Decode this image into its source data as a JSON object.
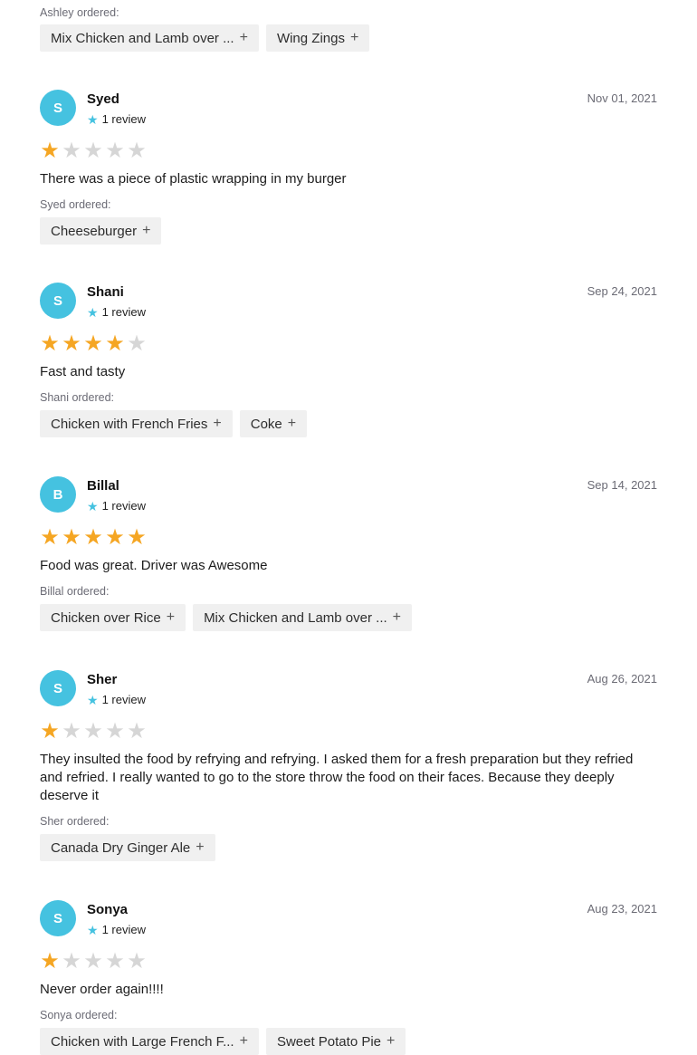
{
  "partial_top": {
    "ordered_label": "Ashley ordered:",
    "items": [
      "Mix Chicken and Lamb over ...",
      "Wing Zings"
    ]
  },
  "plus_glyph": "+",
  "star_glyph": "★",
  "reviews": [
    {
      "initial": "S",
      "name": "Syed",
      "review_count": "1 review",
      "date": "Nov 01, 2021",
      "rating": 1,
      "text": "There was a piece of plastic wrapping in my burger",
      "ordered_label": "Syed ordered:",
      "items": [
        "Cheeseburger"
      ]
    },
    {
      "initial": "S",
      "name": "Shani",
      "review_count": "1 review",
      "date": "Sep 24, 2021",
      "rating": 4,
      "text": "Fast and tasty",
      "ordered_label": "Shani ordered:",
      "items": [
        "Chicken with French Fries",
        "Coke"
      ]
    },
    {
      "initial": "B",
      "name": "Billal",
      "review_count": "1 review",
      "date": "Sep 14, 2021",
      "rating": 5,
      "text": "Food was great. Driver was Awesome",
      "ordered_label": "Billal ordered:",
      "items": [
        "Chicken over Rice",
        "Mix Chicken and Lamb over ..."
      ]
    },
    {
      "initial": "S",
      "name": "Sher",
      "review_count": "1 review",
      "date": "Aug 26, 2021",
      "rating": 1,
      "text": "They insulted the food by refrying and refrying. I asked them for a fresh preparation but they refried and refried. I really wanted to go to the store throw the food on their faces. Because they deeply deserve it",
      "ordered_label": "Sher ordered:",
      "items": [
        "Canada Dry Ginger Ale"
      ]
    },
    {
      "initial": "S",
      "name": "Sonya",
      "review_count": "1 review",
      "date": "Aug 23, 2021",
      "rating": 1,
      "text": "Never order again!!!!",
      "ordered_label": "Sonya ordered:",
      "items": [
        "Chicken with Large French F...",
        "Sweet Potato Pie"
      ]
    }
  ],
  "colors": {
    "avatar": "#45c2e0",
    "star_on": "#f5a623",
    "star_off": "#d6d6d6",
    "chip_bg": "#f0f0f0"
  }
}
